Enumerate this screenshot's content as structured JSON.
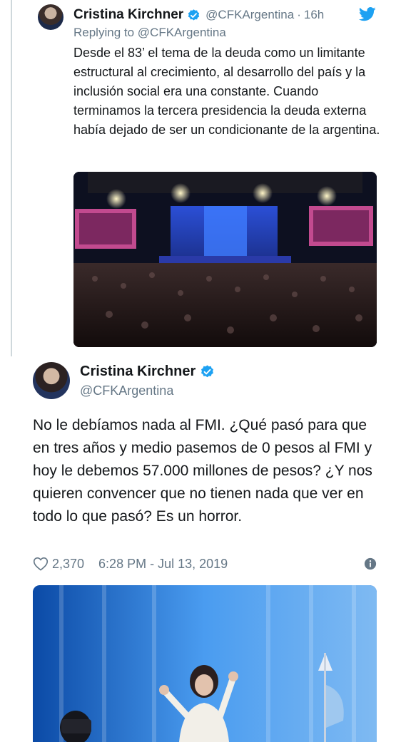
{
  "reply_tweet": {
    "name": "Cristina Kirchner",
    "handle": "@CFKArgentina",
    "separator": "·",
    "time": "16h",
    "replying_prefix": "Replying to",
    "replying_handle": "@CFKArgentina",
    "text": "Desde el 83’ el tema de la deuda como un limitante estructural al crecimiento, al desarrollo del país y la inclusión social era una constante. Cuando terminamos la tercera presidencia la deuda externa había dejado de ser un condicionante de la argentina.",
    "image_alt": "rally-stage-crowd-photo"
  },
  "main_tweet": {
    "name": "Cristina Kirchner",
    "handle": "@CFKArgentina",
    "text": "No le debíamos nada al FMI. ¿Qué pasó para que en tres años y medio pasemos de 0 pesos al FMI y hoy le debemos 57.000 millones de pesos? ¿Y nos quieren convencer que no tienen nada que ver en todo lo que pasó? Es un horror.",
    "likes": "2,370",
    "timestamp": "6:28 PM - Jul 13, 2019",
    "image_alt": "speaker-waving-photo"
  },
  "colors": {
    "twitter_blue": "#1da1f2",
    "secondary_text": "#657786",
    "thread_line": "#cfd8dc"
  },
  "icons": [
    "verified-badge-icon",
    "twitter-bird-icon",
    "heart-icon",
    "info-icon"
  ]
}
